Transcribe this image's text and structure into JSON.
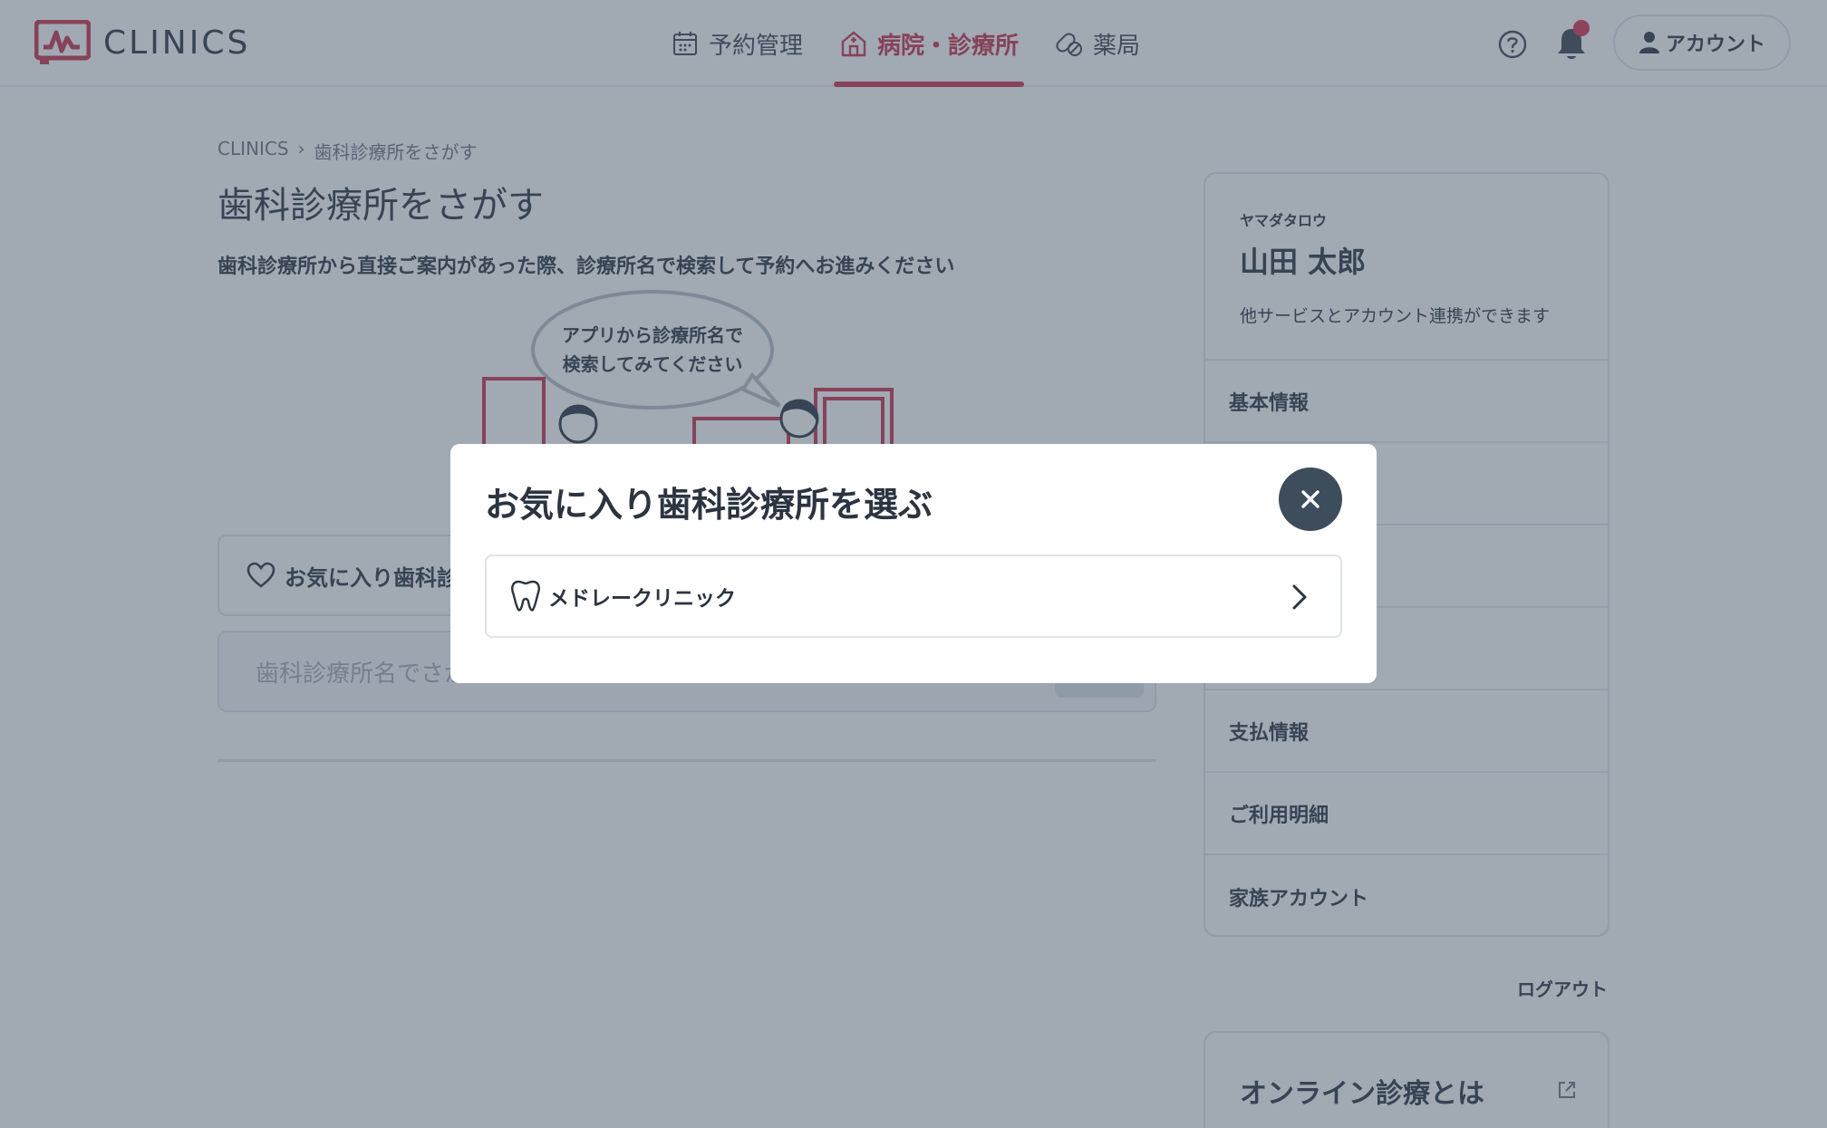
{
  "header": {
    "logo_text": "CLINICS",
    "nav": [
      {
        "label": "予約管理",
        "icon": "calendar-icon",
        "active": false
      },
      {
        "label": "病院・診療所",
        "icon": "hospital-icon",
        "active": true
      },
      {
        "label": "薬局",
        "icon": "pill-icon",
        "active": false
      }
    ],
    "account_label": "アカウント",
    "accent_color": "#c8314a"
  },
  "main": {
    "breadcrumb": [
      "CLINICS",
      "›",
      "歯科診療所をさがす"
    ],
    "title": "歯科診療所をさがす",
    "lead": "歯科診療所から直接ご案内があった際、診療所名で検索して予約へお進みください",
    "bubble_line1": "アプリから診療所名で",
    "bubble_line2": "検索してみてください",
    "favorite_label": "お気に入り歯科診",
    "search_placeholder": "歯科診療所名でさが"
  },
  "profile": {
    "kana": "ヤマダタロウ",
    "name": "山田 太郎",
    "note": "他サービスとアカウント連携ができます",
    "menu": [
      "基本情報",
      "",
      "",
      "",
      "支払情報",
      "ご利用明細",
      "家族アカウント"
    ],
    "logout": "ログアウト",
    "online_title": "オンライン診療とは"
  },
  "modal": {
    "title": "お気に入り歯科診療所を選ぶ",
    "clinics": [
      {
        "name": "メドレークリニック",
        "icon": "tooth-icon"
      }
    ]
  }
}
